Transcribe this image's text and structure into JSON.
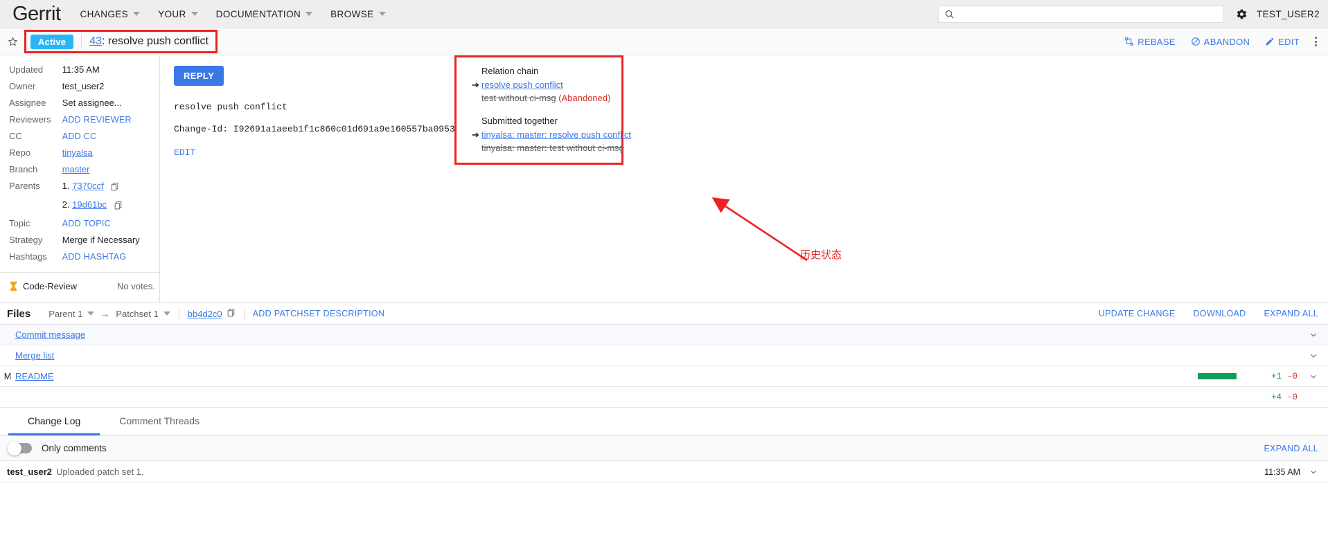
{
  "header": {
    "brand": "Gerrit",
    "nav": [
      {
        "label": "CHANGES",
        "icon": "chevron-down-icon"
      },
      {
        "label": "YOUR",
        "icon": "chevron-down-icon"
      },
      {
        "label": "DOCUMENTATION",
        "icon": "chevron-down-icon"
      },
      {
        "label": "BROWSE",
        "icon": "chevron-down-icon"
      }
    ],
    "search": {
      "placeholder": "",
      "value": "",
      "icon": "search-icon"
    },
    "settings_icon": "gear-icon",
    "username": "TEST_USER2"
  },
  "change": {
    "star_icon": "star-outline-icon",
    "status": "Active",
    "number": "43",
    "separator": ": ",
    "subject": "resolve push conflict",
    "actions": [
      {
        "label": "REBASE",
        "icon": "rebase-icon"
      },
      {
        "label": "ABANDON",
        "icon": "abandon-icon"
      },
      {
        "label": "EDIT",
        "icon": "pencil-icon"
      }
    ],
    "overflow_icon": "kebab-menu-icon"
  },
  "metadata": {
    "rows": [
      {
        "key": "Updated",
        "value": "11:35 AM",
        "type": "text"
      },
      {
        "key": "Owner",
        "value": "test_user2",
        "type": "text"
      },
      {
        "key": "Assignee",
        "value": "Set assignee...",
        "type": "muted"
      },
      {
        "key": "Reviewers",
        "value": "ADD REVIEWER",
        "type": "action"
      },
      {
        "key": "CC",
        "value": "ADD CC",
        "type": "action"
      },
      {
        "key": "Repo",
        "value": "tinyalsa",
        "type": "link"
      },
      {
        "key": "Branch",
        "value": "master",
        "type": "link"
      }
    ],
    "parents_key": "Parents",
    "parents": [
      {
        "index": "1.",
        "sha": "7370ccf",
        "copy_icon": "copy-icon"
      },
      {
        "index": "2.",
        "sha": "19d61bc",
        "copy_icon": "copy-icon"
      }
    ],
    "rows2": [
      {
        "key": "Topic",
        "value": "ADD TOPIC",
        "type": "action"
      },
      {
        "key": "Strategy",
        "value": "Merge if Necessary",
        "type": "text"
      },
      {
        "key": "Hashtags",
        "value": "ADD HASHTAG",
        "type": "action"
      }
    ],
    "label": {
      "icon": "hourglass-icon",
      "name": "Code-Review",
      "value": "No votes."
    }
  },
  "commit": {
    "reply_label": "REPLY",
    "subject": "resolve push conflict",
    "change_id": "Change-Id: I92691a1aeeb1f1c860c01d691a9e160557ba0953",
    "edit_label": "EDIT"
  },
  "relation_panel": {
    "relation_chain": {
      "title": "Relation chain",
      "items": [
        {
          "text": "resolve push conflict",
          "current": true,
          "struck": false,
          "suffix": ""
        },
        {
          "text": "test without ci-msg",
          "current": false,
          "struck": true,
          "suffix": "(Abandoned)"
        }
      ]
    },
    "submitted_together": {
      "title": "Submitted together",
      "items": [
        {
          "text": "tinyalsa: master: resolve push conflict",
          "current": true,
          "struck": false,
          "suffix": ""
        },
        {
          "text": "tinyalsa: master: test without ci-msg",
          "current": false,
          "struck": true,
          "suffix": ""
        }
      ]
    },
    "highlight_color": "#ee2222"
  },
  "annotation": {
    "text": "历史状态",
    "color": "#ee2222"
  },
  "files": {
    "title": "Files",
    "base_select": "Parent 1",
    "arrow": "→",
    "patchset_select": "Patchset 1",
    "sha": "bb4d2c0",
    "copy_icon": "copy-icon",
    "add_description": "ADD PATCHSET DESCRIPTION",
    "actions": [
      "UPDATE CHANGE",
      "DOWNLOAD",
      "EXPAND ALL"
    ],
    "rows": [
      {
        "status": "",
        "name": "Commit message",
        "added": "",
        "removed": "",
        "bar": 0,
        "chevron": "chevron-down-icon"
      },
      {
        "status": "",
        "name": "Merge list",
        "added": "",
        "removed": "",
        "bar": 0,
        "chevron": "chevron-down-icon"
      },
      {
        "status": "M",
        "name": "README",
        "added": "+1",
        "removed": "-0",
        "bar": 56,
        "chevron": "chevron-down-icon"
      }
    ],
    "totals": {
      "added": "+4",
      "removed": "-0"
    }
  },
  "tabs": [
    {
      "label": "Change Log",
      "selected": true
    },
    {
      "label": "Comment Threads",
      "selected": false
    }
  ],
  "changelog": {
    "only_comments_label": "Only comments",
    "toggle_on": false,
    "expand_all": "EXPAND ALL",
    "entries": [
      {
        "user": "test_user2",
        "message": "Uploaded patch set 1.",
        "time": "11:35 AM",
        "chevron": "chevron-down-icon"
      }
    ]
  },
  "colors": {
    "accent": "#3b78e7",
    "active_badge": "#29b6f6",
    "added_green": "#0f9d58",
    "removed_red": "#d93025",
    "highlight_red": "#ee2222"
  }
}
